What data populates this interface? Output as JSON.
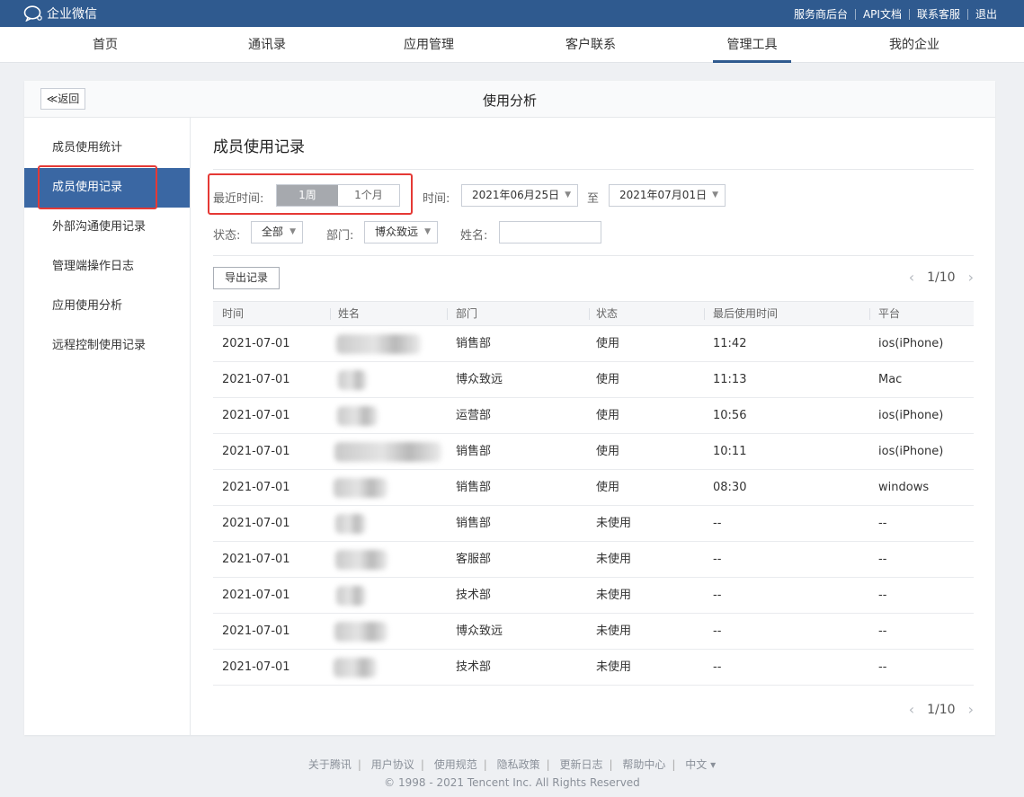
{
  "topbar": {
    "logo_text": "企业微信",
    "links": [
      "服务商后台",
      "API文档",
      "联系客服",
      "退出"
    ]
  },
  "nav": {
    "items": [
      "首页",
      "通讯录",
      "应用管理",
      "客户联系",
      "管理工具",
      "我的企业"
    ],
    "active": "管理工具"
  },
  "card": {
    "back_label": "≪返回",
    "title": "使用分析"
  },
  "sidebar": {
    "items": [
      "成员使用统计",
      "成员使用记录",
      "外部沟通使用记录",
      "管理端操作日志",
      "应用使用分析",
      "远程控制使用记录"
    ],
    "active": "成员使用记录"
  },
  "main": {
    "title": "成员使用记录",
    "filters": {
      "recent_label": "最近时间:",
      "recent_options": [
        "1周",
        "1个月"
      ],
      "recent_selected": "1周",
      "time_label": "时间:",
      "date_from": "2021年06月25日",
      "to_label": "至",
      "date_to": "2021年07月01日",
      "status_label": "状态:",
      "status_value": "全部",
      "dept_label": "部门:",
      "dept_value": "博众致远",
      "name_label": "姓名:",
      "name_value": ""
    },
    "export_label": "导出记录",
    "pagination": "1/10",
    "columns": [
      "时间",
      "姓名",
      "部门",
      "状态",
      "最后使用时间",
      "平台"
    ],
    "rows": [
      {
        "date": "2021-07-01",
        "dept": "销售部",
        "status": "使用",
        "last": "11:42",
        "platform": "ios(iPhone)"
      },
      {
        "date": "2021-07-01",
        "dept": "博众致远",
        "status": "使用",
        "last": "11:13",
        "platform": "Mac"
      },
      {
        "date": "2021-07-01",
        "dept": "运营部",
        "status": "使用",
        "last": "10:56",
        "platform": "ios(iPhone)"
      },
      {
        "date": "2021-07-01",
        "dept": "销售部",
        "status": "使用",
        "last": "10:11",
        "platform": "ios(iPhone)"
      },
      {
        "date": "2021-07-01",
        "dept": "销售部",
        "status": "使用",
        "last": "08:30",
        "platform": "windows"
      },
      {
        "date": "2021-07-01",
        "dept": "销售部",
        "status": "未使用",
        "last": "--",
        "platform": "--"
      },
      {
        "date": "2021-07-01",
        "dept": "客服部",
        "status": "未使用",
        "last": "--",
        "platform": "--"
      },
      {
        "date": "2021-07-01",
        "dept": "技术部",
        "status": "未使用",
        "last": "--",
        "platform": "--"
      },
      {
        "date": "2021-07-01",
        "dept": "博众致远",
        "status": "未使用",
        "last": "--",
        "platform": "--"
      },
      {
        "date": "2021-07-01",
        "dept": "技术部",
        "status": "未使用",
        "last": "--",
        "platform": "--"
      }
    ]
  },
  "footer": {
    "links": [
      "关于腾讯",
      "用户协议",
      "使用规范",
      "隐私政策",
      "更新日志",
      "帮助中心",
      "中文 ▾"
    ],
    "copyright": "© 1998 - 2021 Tencent Inc. All Rights Reserved"
  },
  "colors": {
    "topbar": "#2f5a8f",
    "sidebar_active": "#3a67a3",
    "highlight": "#e53935"
  }
}
